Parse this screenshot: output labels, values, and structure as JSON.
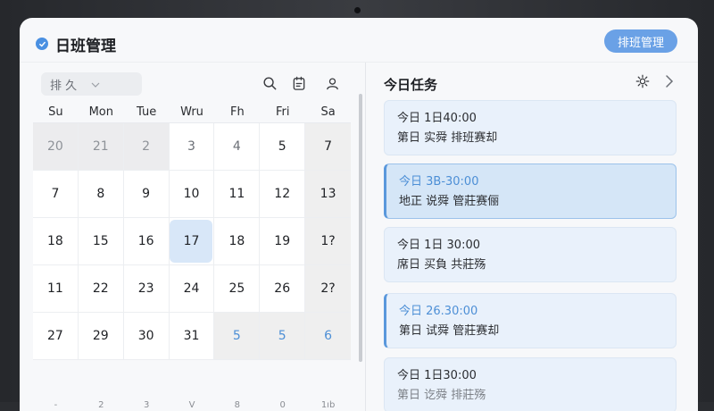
{
  "app": {
    "title": "日班管理",
    "header_button": "排班管理"
  },
  "calendar": {
    "view_select": "排 久",
    "weekdays": [
      "Su",
      "Mon",
      "Tue",
      "Wru",
      "Fh",
      "Fri",
      "Sa"
    ],
    "weeks": [
      [
        "20",
        "21",
        "2",
        "3",
        "4",
        "5",
        "7"
      ],
      [
        "7",
        "8",
        "9",
        "10",
        "11",
        "12",
        "13"
      ],
      [
        "18",
        "15",
        "16",
        "17",
        "18",
        "19",
        "1?"
      ],
      [
        "11",
        "22",
        "23",
        "24",
        "25",
        "26",
        "2?"
      ],
      [
        "27",
        "29",
        "30",
        "31",
        "5",
        "5",
        "6"
      ]
    ],
    "footer": [
      "-",
      "2",
      "3",
      "V",
      "8",
      "0",
      "1ıb"
    ]
  },
  "tasks_panel": {
    "title": "今日任务",
    "tasks": [
      {
        "time": "今日 1日40:00",
        "desc": "第日 实舜 排班赛却"
      },
      {
        "time": "今日 3B-30:00",
        "desc": "地正 说舜 管莊赛俪"
      },
      {
        "time": "今日 1日 30:00",
        "desc": "席日 买負 共莊殇"
      },
      {
        "time": "今日 26.30:00",
        "desc": "第日 试舜 管莊赛却"
      },
      {
        "time": "今日 1日30:00",
        "desc": "第日 讫舜 排莊殇"
      }
    ]
  },
  "colors": {
    "accent": "#4a90e2",
    "today_highlight": "#d8e7f8",
    "task_bg": "#e9f1fb"
  }
}
